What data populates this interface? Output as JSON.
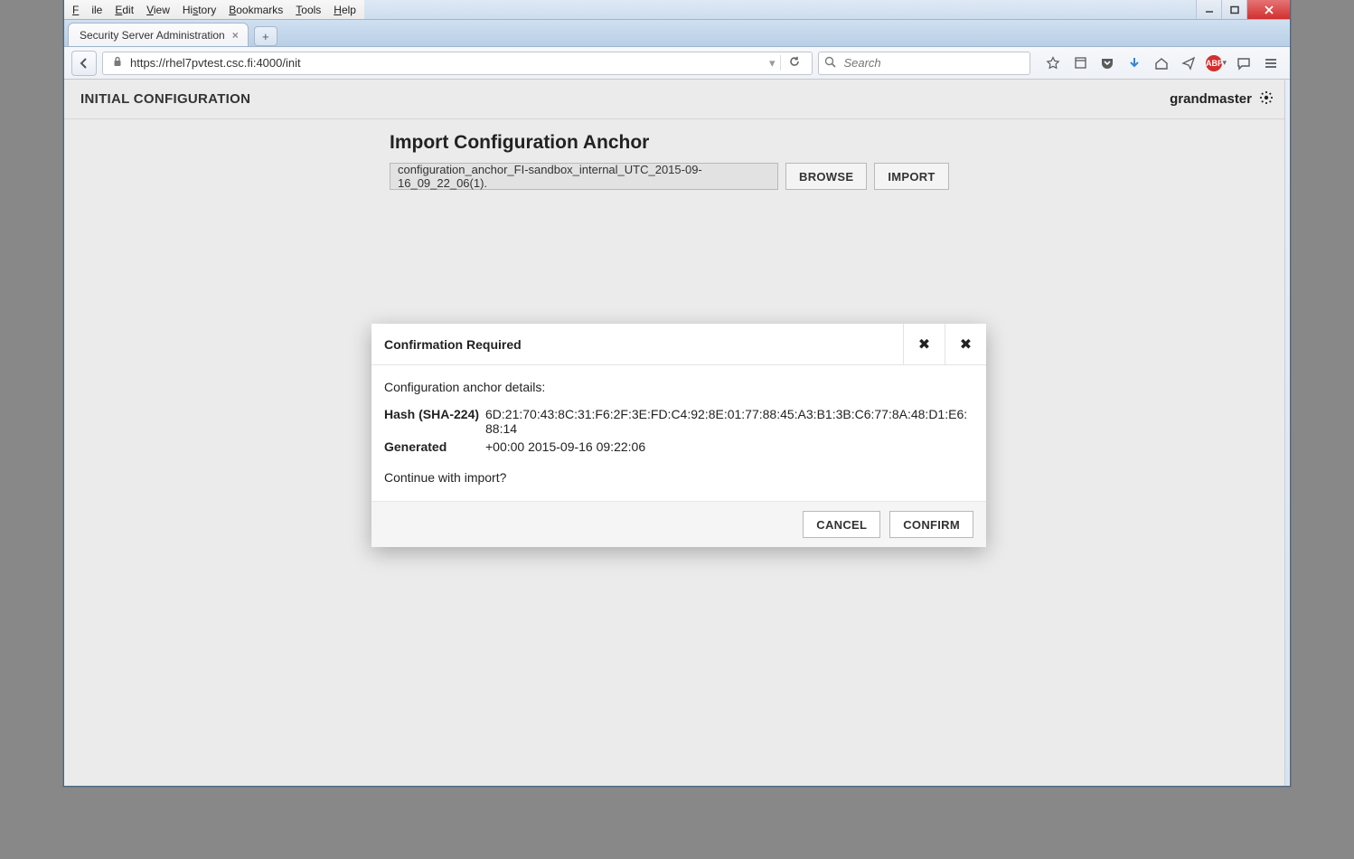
{
  "menus": {
    "file": "File",
    "edit": "Edit",
    "view": "View",
    "history": "History",
    "bookmarks": "Bookmarks",
    "tools": "Tools",
    "help": "Help"
  },
  "tab": {
    "title": "Security Server Administration"
  },
  "url": {
    "value": "https://rhel7pvtest.csc.fi:4000/init"
  },
  "search": {
    "placeholder": "Search"
  },
  "header": {
    "title": "INITIAL CONFIGURATION",
    "user": "grandmaster"
  },
  "import": {
    "heading": "Import Configuration Anchor",
    "filename": "configuration_anchor_FI-sandbox_internal_UTC_2015-09-16_09_22_06(1).",
    "browse": "BROWSE",
    "import": "IMPORT"
  },
  "modal": {
    "title": "Confirmation Required",
    "lead": "Configuration anchor details:",
    "hash_label": "Hash (SHA-224)",
    "hash_value": "6D:21:70:43:8C:31:F6:2F:3E:FD:C4:92:8E:01:77:88:45:A3:B1:3B:C6:77:8A:48:D1:E6:88:14",
    "gen_label": "Generated",
    "gen_value": "+00:00 2015-09-16 09:22:06",
    "trail": "Continue with import?",
    "cancel": "CANCEL",
    "confirm": "CONFIRM"
  }
}
